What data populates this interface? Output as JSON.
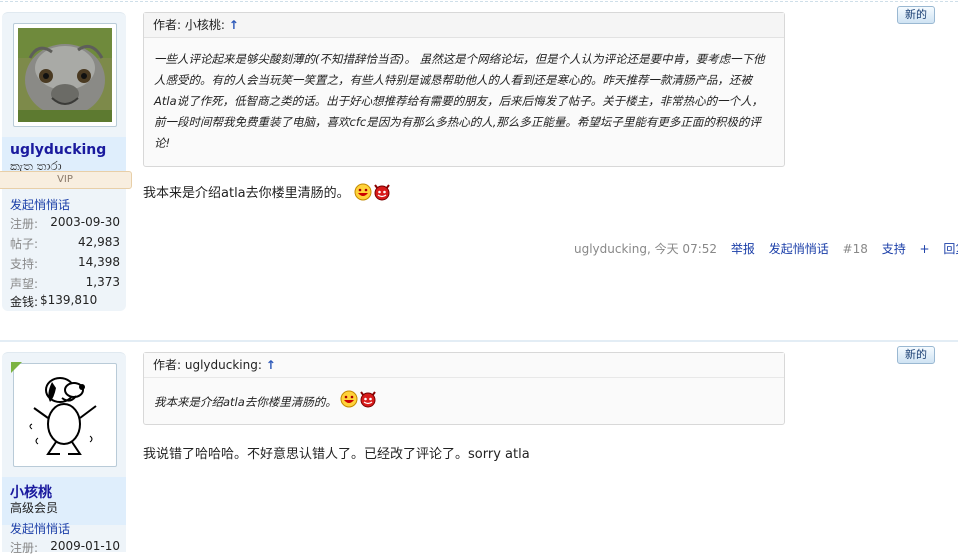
{
  "posts": [
    {
      "user": {
        "name": "uglyducking",
        "subtitle": "කැත තාරා",
        "rank": "VIP",
        "pm_label": "发起悄悄话",
        "stats": [
          {
            "k": "注册:",
            "v": "2003-09-30"
          },
          {
            "k": "帖子:",
            "v": "42,983"
          },
          {
            "k": "支持:",
            "v": "14,398"
          },
          {
            "k": "声望:",
            "v": "1,373"
          }
        ],
        "money": {
          "k": "金钱:",
          "v": "$139,810"
        },
        "avatar_icon": "ostrich-avatar"
      },
      "new_badge": "新的",
      "quote": {
        "author_prefix": "作者: 小核桃:",
        "body": "一些人评论起来是够尖酸刻薄的(不知措辞恰当否)。 虽然这是个网络论坛，但是个人认为评论还是要中肯，要考虑一下他人感受的。有的人会当玩笑一笑置之，有些人特别是诚恳帮助他人的人看到还是寒心的。昨天推荐一款清肠产品，还被Atla说了作死，低智商之类的话。出于好心想推荐给有需要的朋友，后来后悔发了帖子。关于楼主，非常热心的一个人，前一段时间帮我免费重装了电脑，喜欢cfc是因为有那么多热心的人,那么多正能量。希望坛子里能有更多正面的积极的评论!"
      },
      "message": "我本来是介绍atla去你楼里清肠的。",
      "footer": {
        "author_time": "uglyducking, 今天 07:52",
        "report": "举报",
        "pm": "发起悄悄话",
        "floor": "#18",
        "support": "支持",
        "plus": "+",
        "reply": "回复"
      }
    },
    {
      "user": {
        "name": "小核桃",
        "subtitle": "高级会员",
        "pm_label": "发起悄悄话",
        "stats": [
          {
            "k": "注册:",
            "v": "2009-01-10"
          }
        ],
        "avatar_icon": "snoopy-avatar"
      },
      "new_badge": "新的",
      "quote": {
        "author_prefix": "作者: uglyducking:",
        "body": "我本来是介绍atla去你楼里清肠的。"
      },
      "message": "我说错了哈哈哈。不好意思认错人了。已经改了评论了。sorry atla"
    }
  ],
  "emoticons": [
    "laughing-emoticon",
    "devil-emoticon"
  ]
}
